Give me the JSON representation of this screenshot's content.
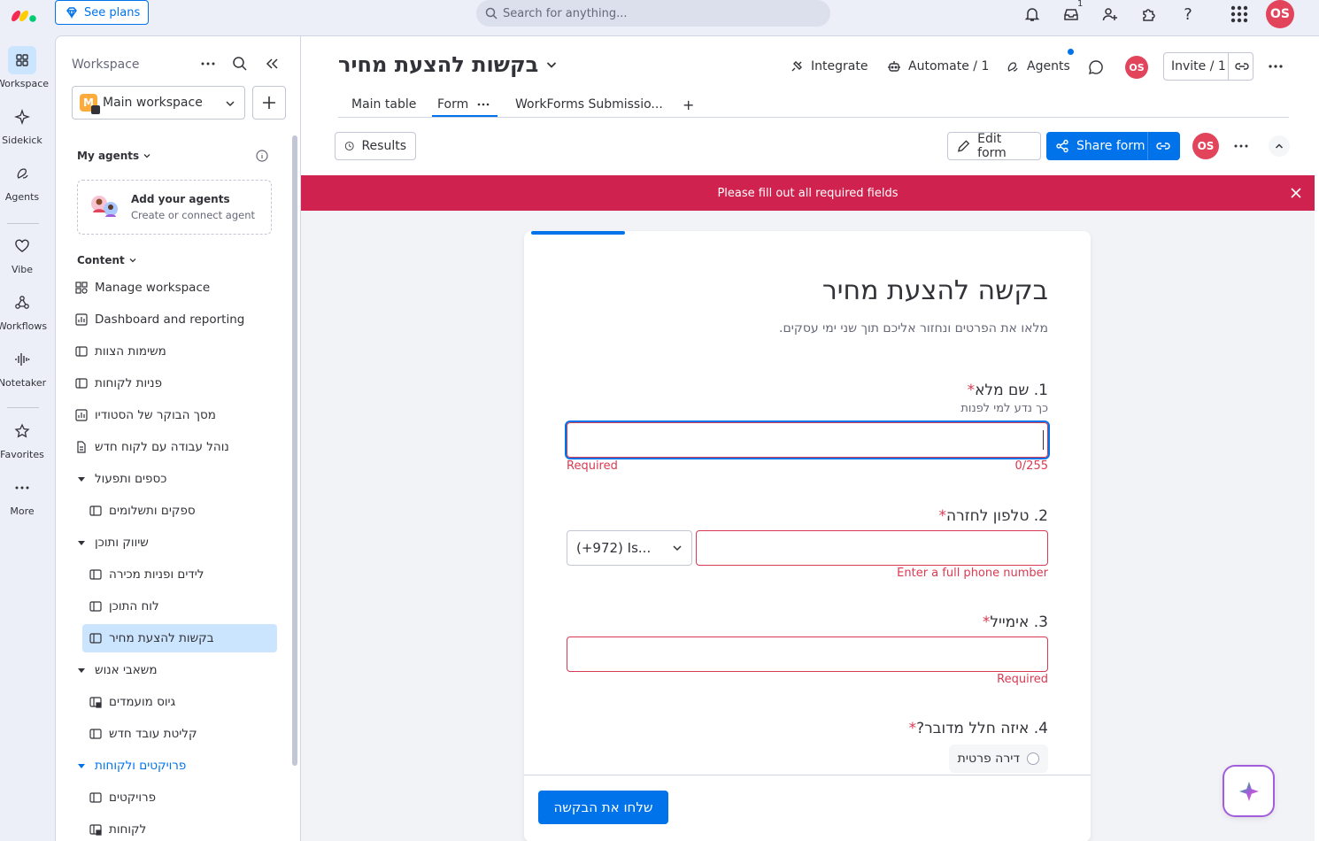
{
  "topbar": {
    "see_plans": "See plans",
    "search_placeholder": "Search for anything...",
    "inbox_count": "1",
    "user_initials": "OS"
  },
  "rail": [
    {
      "label": "Workspace",
      "icon": "grid-icon",
      "active": true
    },
    {
      "label": "Sidekick",
      "icon": "sparkle-icon"
    },
    {
      "label": "Agents",
      "icon": "agents-icon"
    },
    {
      "label": "Vibe",
      "icon": "heart-icon"
    },
    {
      "label": "Workflows",
      "icon": "workflows-icon"
    },
    {
      "label": "Notetaker",
      "icon": "waveform-icon"
    },
    {
      "label": "Favorites",
      "icon": "star-icon"
    },
    {
      "label": "More",
      "icon": "dots-icon"
    }
  ],
  "sidebar": {
    "title": "Workspace",
    "workspace_letter": "M",
    "workspace_name": "Main workspace",
    "my_agents": "My agents",
    "agent_card_title": "Add your agents",
    "agent_card_sub": "Create or connect agent",
    "content": "Content",
    "items": [
      {
        "label": "Manage workspace",
        "icon": "manage-icon",
        "indent": 0
      },
      {
        "label": "Dashboard and reporting",
        "icon": "dashboard-icon",
        "indent": 0
      },
      {
        "label": "משימות הצוות",
        "icon": "board-icon",
        "indent": 0
      },
      {
        "label": "פניות לקוחות",
        "icon": "board-icon",
        "indent": 0
      },
      {
        "label": "מסך הבוקר של הסטודיו",
        "icon": "dashboard-icon",
        "indent": 0
      },
      {
        "label": "נוהל עבודה עם לקוח חדש",
        "icon": "doc-icon",
        "indent": 0
      },
      {
        "label": "כספים ותפעול",
        "icon": "folder-caret-icon",
        "indent": 0
      },
      {
        "label": "ספקים ותשלומים",
        "icon": "board-icon",
        "indent": 1
      },
      {
        "label": "שיווק ותוכן",
        "icon": "folder-caret-icon",
        "indent": 0
      },
      {
        "label": "לידים ופניות מכירה",
        "icon": "board-icon",
        "indent": 1
      },
      {
        "label": "לוח התוכן",
        "icon": "board-icon",
        "indent": 1
      },
      {
        "label": "בקשות להצעת מחיר",
        "icon": "board-icon",
        "indent": 1,
        "active": true
      },
      {
        "label": "משאבי אנוש",
        "icon": "folder-caret-icon",
        "indent": 0
      },
      {
        "label": "גיוס מועמדים",
        "icon": "board-lock-icon",
        "indent": 1
      },
      {
        "label": "קליטת עובד חדש",
        "icon": "board-icon",
        "indent": 1
      },
      {
        "label": "פרויקטים ולקוחות",
        "icon": "folder-caret-icon",
        "indent": 0,
        "blue": true
      },
      {
        "label": "פרויקטים",
        "icon": "board-icon",
        "indent": 1
      },
      {
        "label": "לקוחות",
        "icon": "board-lock-icon",
        "indent": 1
      }
    ]
  },
  "board": {
    "title": "בקשות להצעת מחיר",
    "integrate": "Integrate",
    "automate": "Automate / 1",
    "agents": "Agents",
    "invite": "Invite / 1",
    "tabs": [
      "Main table",
      "Form",
      "WorkForms Submissio..."
    ],
    "results": "Results",
    "edit_form": "Edit form",
    "share_form": "Share form",
    "banner": "Please fill out all required fields"
  },
  "form": {
    "title": "בקשה להצעת מחיר",
    "description": "מלאו את הפרטים ונחזור אליכם תוך שני ימי עסקים.",
    "q1_label": "1. שם מלא",
    "q1_hint": "כך נדע למי לפנות",
    "q1_error": "Required",
    "q1_counter": "0/255",
    "q2_label": "2. טלפון לחזרה",
    "q2_country": "(+972) Is...",
    "q2_error": "Enter a full phone number",
    "q3_label": "3. אימייל",
    "q3_error": "Required",
    "q4_label": "4. איזה חלל מדובר?",
    "q4_option": "דירה פרטית",
    "required_mark": "*",
    "submit": "שלחו את הבקשה"
  },
  "colors": {
    "accent": "#0073ea",
    "error": "#d83a52",
    "banner": "#d0224f",
    "avatar": "#e2445c",
    "selected": "#cce5ff"
  }
}
